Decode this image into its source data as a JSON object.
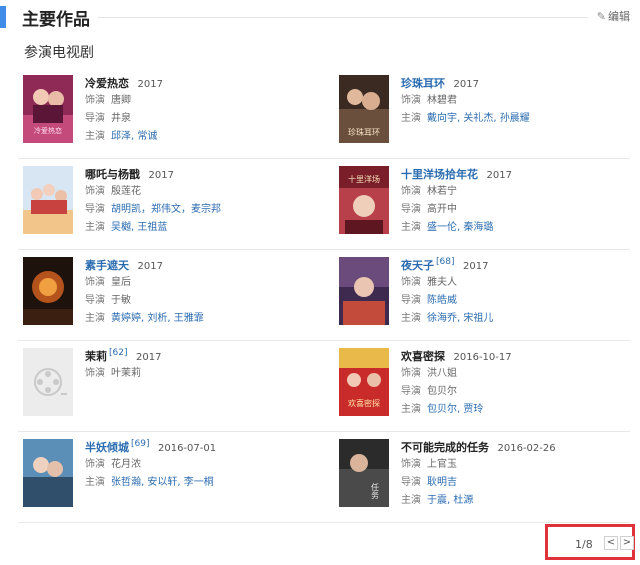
{
  "section": {
    "title": "主要作品",
    "edit_label": "编辑"
  },
  "subheading": "参演电视剧",
  "labels": {
    "role": "饰演",
    "director": "导演",
    "cast": "主演"
  },
  "works": [
    {
      "title": "冷爱热恋",
      "title_link": false,
      "sup": "",
      "year": "2017",
      "role": "唐卿",
      "director": "井泉",
      "director_link": false,
      "cast": "邱泽, 常诚"
    },
    {
      "title": "珍珠耳环",
      "title_link": true,
      "sup": "",
      "year": "2017",
      "role": "林碧君",
      "director": "",
      "director_link": false,
      "cast": "戴向宇, 关礼杰, 孙晨耀"
    },
    {
      "title": "哪吒与杨戬",
      "title_link": false,
      "sup": "",
      "year": "2017",
      "role": "殷莲花",
      "director": "胡明凯，郑伟文，麦宗邦",
      "director_link": true,
      "cast": "吴樾, 王祖蓝"
    },
    {
      "title": "十里洋场拾年花",
      "title_link": true,
      "sup": "",
      "year": "2017",
      "role": "林若宁",
      "director": "高开中",
      "director_link": false,
      "cast": "盛一伦, 秦海璐"
    },
    {
      "title": "素手遮天",
      "title_link": true,
      "sup": "",
      "year": "2017",
      "role": "皇后",
      "director": "于敏",
      "director_link": false,
      "cast": "黄婷婷, 刘析, 王雅霏"
    },
    {
      "title": "夜天子",
      "title_link": true,
      "sup": "[68]",
      "year": "2017",
      "role": "雅夫人",
      "director": "陈皓威",
      "director_link": true,
      "cast": "徐海乔, 宋祖儿"
    },
    {
      "title": "茉莉",
      "title_link": false,
      "sup": "[62]",
      "year": "2017",
      "role": "叶茉莉",
      "director": "",
      "director_link": false,
      "cast": ""
    },
    {
      "title": "欢喜密探",
      "title_link": false,
      "sup": "",
      "year": "2016-10-17",
      "role": "洪八姐",
      "director": "包贝尔",
      "director_link": false,
      "cast": "包贝尔, 贾玲"
    },
    {
      "title": "半妖倾城",
      "title_link": true,
      "sup": "[69]",
      "year": "2016-07-01",
      "role": "花月浓",
      "director": "",
      "director_link": false,
      "cast": "张哲瀚, 安以轩, 李一桐"
    },
    {
      "title": "不可能完成的任务",
      "title_link": false,
      "sup": "",
      "year": "2016-02-26",
      "role": "上官玉",
      "director": "耿明吉",
      "director_link": true,
      "cast": "于震, 杜源"
    }
  ],
  "pager": {
    "count": "1/8",
    "prev": "<",
    "next": ">"
  }
}
